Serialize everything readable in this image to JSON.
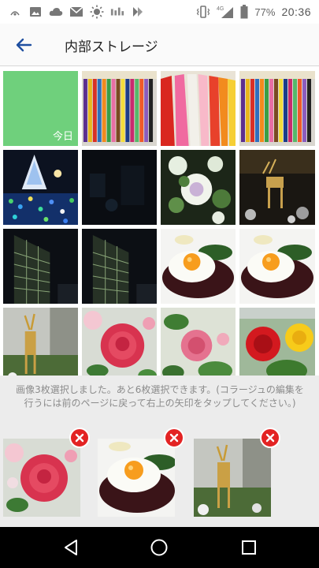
{
  "status_bar": {
    "left_icons": [
      "nfc-icon",
      "image-icon",
      "cloud-icon",
      "mail-icon",
      "brightness-icon",
      "signal-text-icon",
      "app-icon"
    ],
    "network": "4G",
    "battery": "77%",
    "time": "20:36"
  },
  "app_bar": {
    "title": "内部ストレージ"
  },
  "grid": {
    "today_label": "今日",
    "photos": [
      "colored-pencils",
      "colored-pencils-closeup",
      "colored-pencils",
      "illuminated-tree-night",
      "dark-night-scene",
      "ornamental-cabbage",
      "reindeer-illumination",
      "office-tower-night",
      "office-tower-night",
      "fried-egg-hamburg-steak",
      "fried-egg-hamburg-steak",
      "golden-reindeer",
      "pink-rose",
      "pink-rose",
      "red-and-yellow-roses"
    ]
  },
  "tray": {
    "message": "画像3枚選択しました。あと6枚選択できます。(コラージュの編集を行うには前のページに戻って右上の矢印をタップしてください。)",
    "selected": [
      "pink-rose",
      "fried-egg-hamburg-steak",
      "golden-reindeer"
    ]
  },
  "colors": {
    "accent": "#1f4fa0",
    "today_tile": "#6fd07c",
    "remove_badge": "#e32323"
  }
}
